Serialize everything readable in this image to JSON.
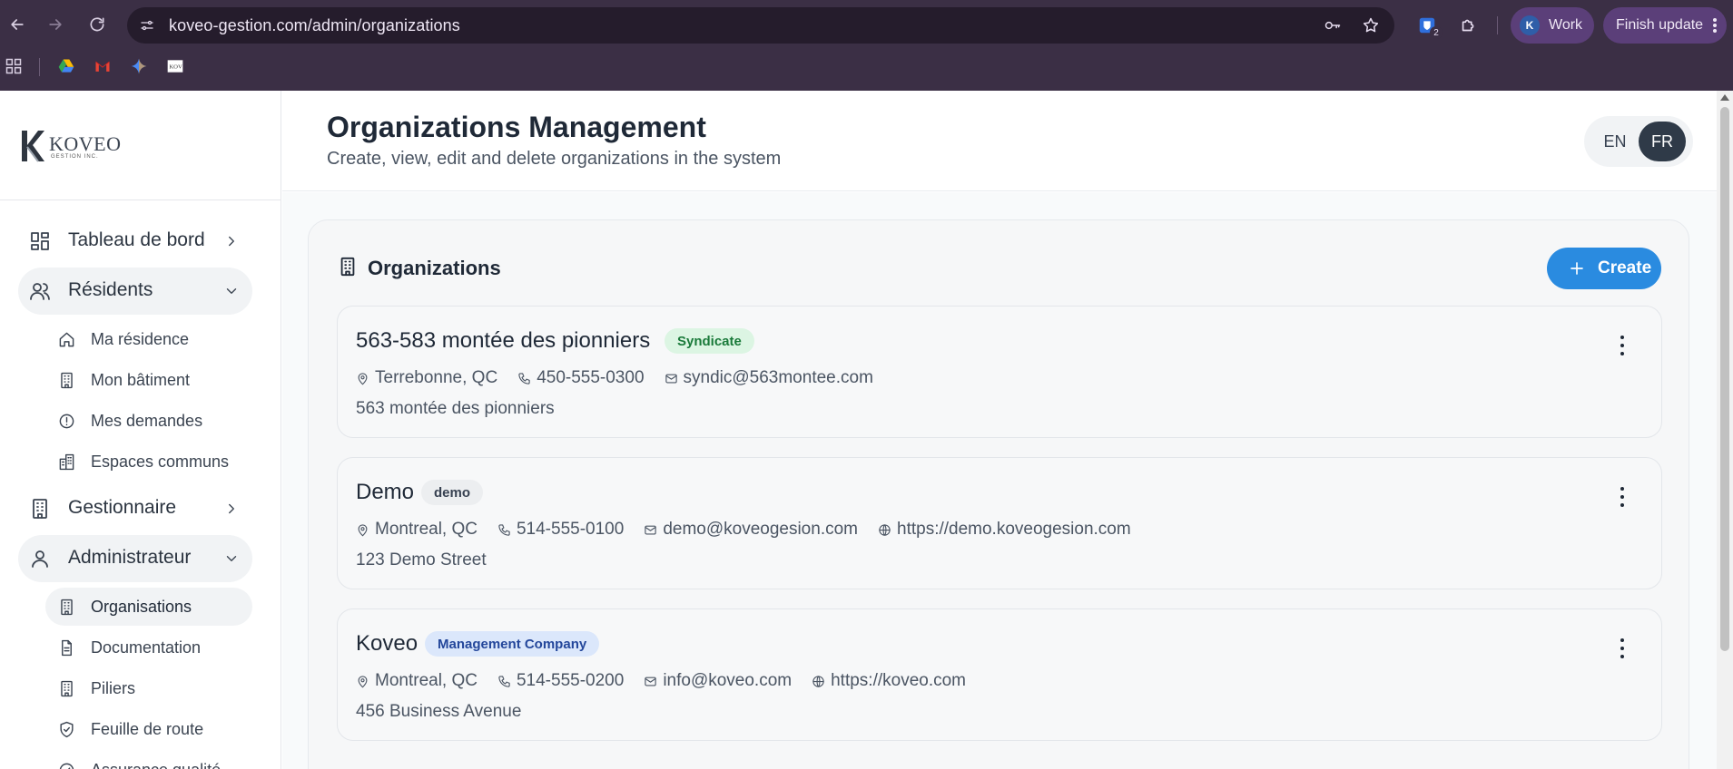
{
  "browser": {
    "url": "koveo-gestion.com/admin/organizations",
    "profile_initial": "K",
    "profile_label": "Work",
    "finish_update": "Finish update",
    "extension_badge": "2"
  },
  "sidebar": {
    "logo_word": "KOVEO",
    "logo_sub": "GESTION INC.",
    "items": [
      {
        "label": "Tableau de bord"
      },
      {
        "label": "Résidents"
      },
      {
        "label": "Ma résidence"
      },
      {
        "label": "Mon bâtiment"
      },
      {
        "label": "Mes demandes"
      },
      {
        "label": "Espaces communs"
      },
      {
        "label": "Gestionnaire"
      },
      {
        "label": "Administrateur"
      },
      {
        "label": "Organisations"
      },
      {
        "label": "Documentation"
      },
      {
        "label": "Piliers"
      },
      {
        "label": "Feuille de route"
      },
      {
        "label": "Assurance qualité"
      }
    ]
  },
  "header": {
    "title": "Organizations Management",
    "subtitle": "Create, view, edit and delete organizations in the system",
    "lang_en": "EN",
    "lang_fr": "FR"
  },
  "organizations_card": {
    "title": "Organizations",
    "create_label": "Create",
    "orgs": [
      {
        "name": "563-583 montée des pionniers",
        "badge": "Syndicate",
        "city": "Terrebonne, QC",
        "phone": "450-555-0300",
        "email": "syndic@563montee.com",
        "website": "",
        "address": "563 montée des pionniers"
      },
      {
        "name": "Demo",
        "badge": "demo",
        "city": "Montreal, QC",
        "phone": "514-555-0100",
        "email": "demo@koveogesion.com",
        "website": "https://demo.koveogesion.com",
        "address": "123 Demo Street"
      },
      {
        "name": "Koveo",
        "badge": "Management Company",
        "city": "Montreal, QC",
        "phone": "514-555-0200",
        "email": "info@koveo.com",
        "website": "https://koveo.com",
        "address": "456 Business Avenue"
      }
    ]
  },
  "colors": {
    "browser_bg": "#3b2f45",
    "accent_blue": "#2a8be0",
    "lang_active": "#2f3a48"
  }
}
